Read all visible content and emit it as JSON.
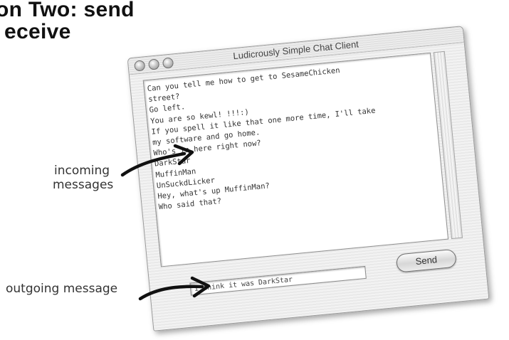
{
  "heading": {
    "line1": "on Two: send",
    "line2": "eceive"
  },
  "window": {
    "title": "Ludicrously Simple Chat Client",
    "messages": [
      "Can you tell me how to get to SesameChicken",
      "street?",
      "Go left.",
      "You are so kewl! !!!:)",
      "If you spell it like that one more time, I'll take",
      "my software and go home.",
      "Who's in here right now?",
      "DarkStar",
      "MuffinMan",
      "UnSuckdLicker",
      "Hey, what's up MuffinMan?",
      "Who said that?"
    ],
    "outgoing_value": "I think it was DarkStar",
    "send_label": "Send"
  },
  "annotations": {
    "incoming_line1": "incoming",
    "incoming_line2": "messages",
    "outgoing": "outgoing message"
  },
  "colors": {
    "ink": "#222222",
    "window_bg": "#eeeeee",
    "chat_bg": "#ffffff"
  }
}
